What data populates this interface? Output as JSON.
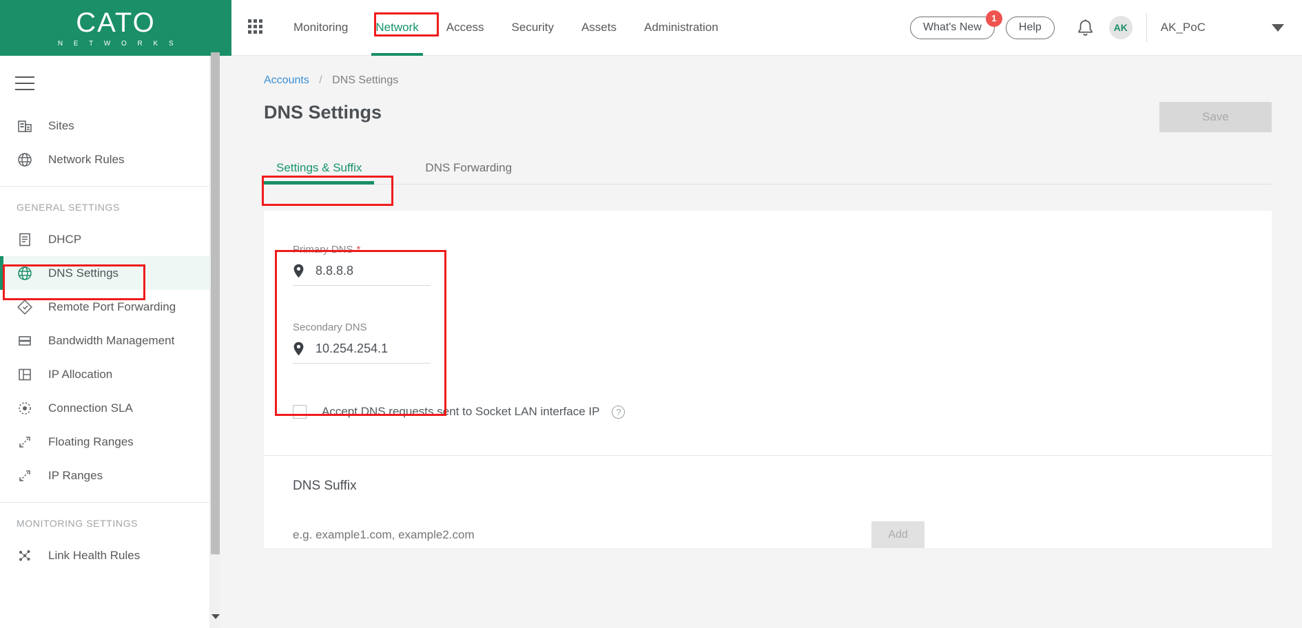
{
  "brand": {
    "name": "CATO",
    "tagline": "N E T W O R K S",
    "color": "#1a8f68"
  },
  "topnav": {
    "apps_icon": "grid-apps-icon",
    "items": [
      {
        "label": "Monitoring",
        "active": false
      },
      {
        "label": "Network",
        "active": true
      },
      {
        "label": "Access",
        "active": false
      },
      {
        "label": "Security",
        "active": false
      },
      {
        "label": "Assets",
        "active": false
      },
      {
        "label": "Administration",
        "active": false
      }
    ],
    "whats_new": {
      "label": "What's New",
      "badge": "1",
      "badge_color": "#ef5350"
    },
    "help": {
      "label": "Help"
    },
    "notifications_icon": "bell-icon",
    "avatar": {
      "initials": "AK"
    },
    "account": {
      "name": "AK_PoC",
      "caret_icon": "chevron-down-icon"
    }
  },
  "sidebar": {
    "menu_icon": "hamburger-icon",
    "items": [
      {
        "label": "Sites",
        "icon": "building-icon",
        "selected": false
      },
      {
        "label": "Network Rules",
        "icon": "globe-icon",
        "selected": false
      }
    ],
    "sections": [
      {
        "title": "GENERAL SETTINGS",
        "items": [
          {
            "label": "DHCP",
            "icon": "document-list-icon",
            "selected": false
          },
          {
            "label": "DNS Settings",
            "icon": "globe-icon",
            "selected": true
          },
          {
            "label": "Remote Port Forwarding",
            "icon": "diamond-icon",
            "selected": false
          },
          {
            "label": "Bandwidth Management",
            "icon": "stacked-bars-icon",
            "selected": false
          },
          {
            "label": "IP Allocation",
            "icon": "grid-layout-icon",
            "selected": false
          },
          {
            "label": "Connection SLA",
            "icon": "target-dot-icon",
            "selected": false
          },
          {
            "label": "Floating Ranges",
            "icon": "expand-arrows-icon",
            "selected": false
          },
          {
            "label": "IP Ranges",
            "icon": "expand-arrows-icon",
            "selected": false
          }
        ]
      },
      {
        "title": "MONITORING SETTINGS",
        "items": [
          {
            "label": "Link Health Rules",
            "icon": "nodes-icon",
            "selected": false
          }
        ]
      }
    ]
  },
  "breadcrumb": {
    "root": "Accounts",
    "separator": "/",
    "current": "DNS Settings"
  },
  "page": {
    "title": "DNS Settings",
    "save_label": "Save",
    "save_disabled": true
  },
  "tabs": [
    {
      "label": "Settings & Suffix",
      "active": true
    },
    {
      "label": "DNS Forwarding",
      "active": false
    }
  ],
  "form": {
    "primary_dns": {
      "label": "Primary DNS",
      "required_marker": "*",
      "value": "8.8.8.8",
      "icon": "location-pin-icon"
    },
    "secondary_dns": {
      "label": "Secondary DNS",
      "value": "10.254.254.1",
      "icon": "location-pin-icon"
    },
    "accept_lan_checkbox": {
      "label": "Accept DNS requests sent to Socket LAN interface IP",
      "checked": false,
      "help_icon": "question-mark-icon",
      "help_glyph": "?"
    }
  },
  "dns_suffix": {
    "title": "DNS Suffix",
    "placeholder": "e.g. example1.com, example2.com",
    "value": "",
    "add_label": "Add",
    "add_disabled": true
  },
  "annotations": {
    "color": "#f01b1b",
    "boxes": [
      "network-tab-highlight",
      "sidebar-dns-settings-highlight",
      "settings-suffix-tab-highlight",
      "dns-fields-highlight"
    ]
  }
}
